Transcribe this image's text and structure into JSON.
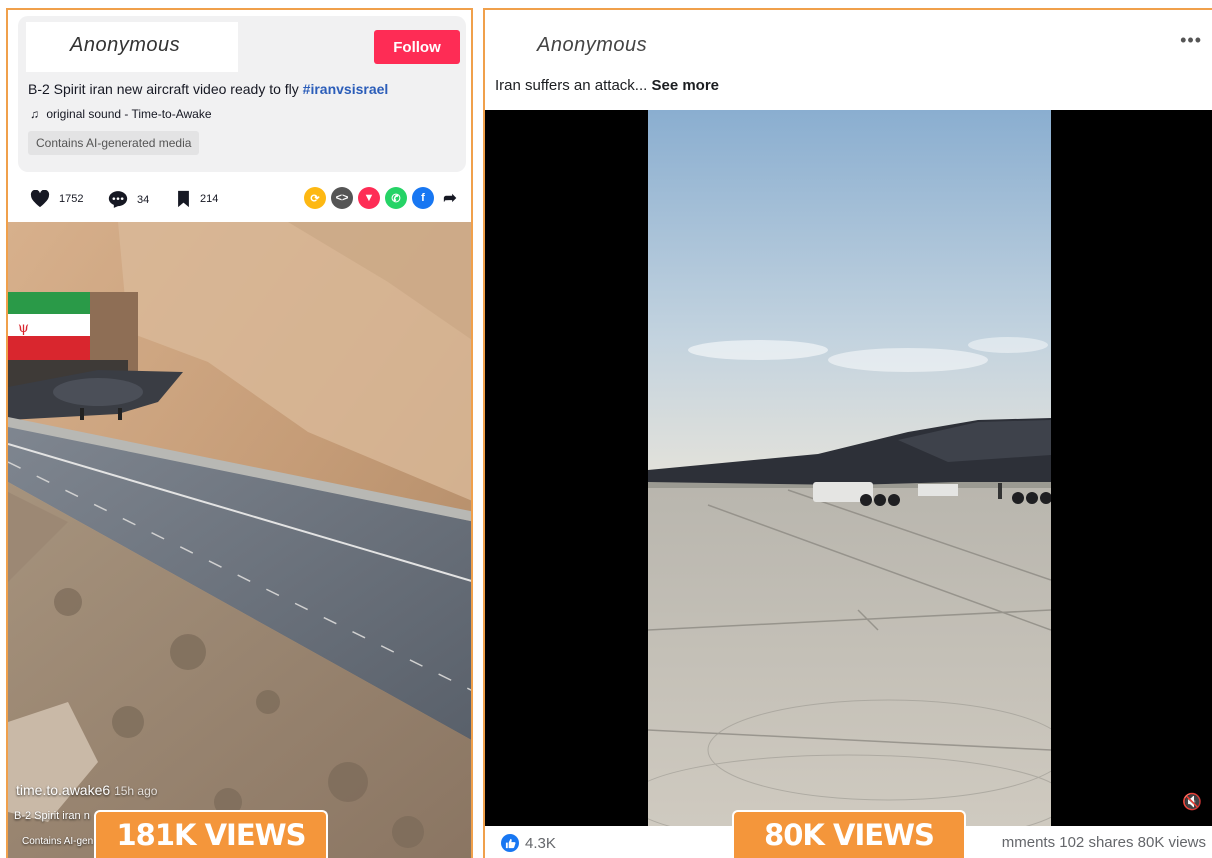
{
  "left_post": {
    "username": "Anonymous",
    "follow_label": "Follow",
    "caption": "B-2 Spirit iran new aircraft video ready to fly ",
    "hashtag": "#iranvsisrael",
    "sound": "original sound - Time-to-Awake",
    "ai_label": "Contains AI-generated media",
    "likes": "1752",
    "comments": "34",
    "saves": "214",
    "share_icons": [
      "repost-icon",
      "embed-icon",
      "send-icon",
      "whatsapp-icon",
      "facebook-icon",
      "share-arrow-icon"
    ],
    "overlay_user": "time.to.awake6",
    "overlay_time": "15h ago",
    "overlay_caption": "B-2 Spirit iran n",
    "overlay_ai": "Contains AI-gen",
    "views_badge": "181K VIEWS"
  },
  "right_post": {
    "username": "Anonymous",
    "more_label": "•••",
    "text": "Iran suffers an attack... ",
    "see_more": "See more",
    "reactions": "4.3K",
    "stats_tail": "mments  102 shares  80K views",
    "mute_icon": "muted-speaker-icon",
    "views_badge": "80K VIEWS"
  },
  "colors": {
    "accent_orange": "#f4963b",
    "border_orange": "#f0a04b",
    "tiktok_red": "#fe2c55",
    "facebook_blue": "#1877f2",
    "hashtag_blue": "#2b5db9"
  }
}
